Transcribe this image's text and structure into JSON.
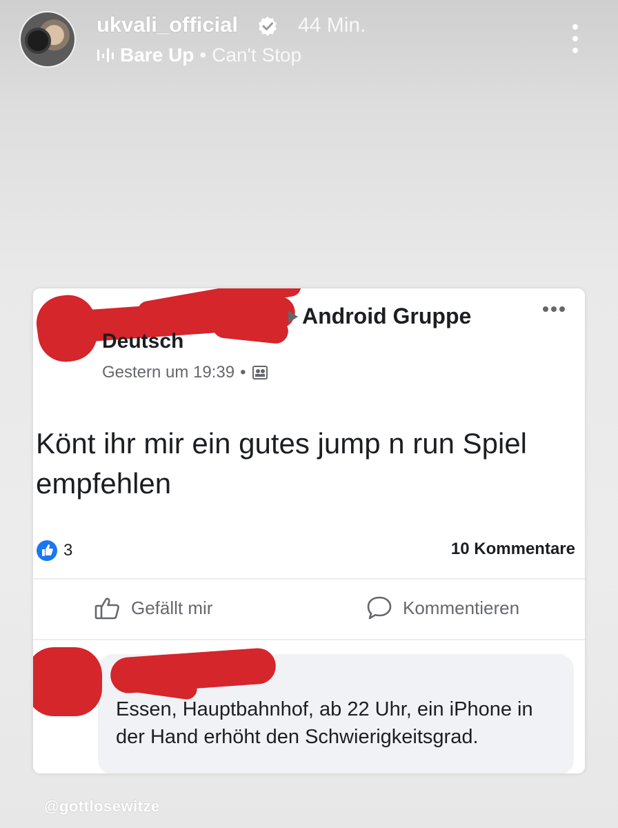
{
  "story": {
    "username": "ukvali_official",
    "time": "44 Min.",
    "song": "Bare Up",
    "separator": "•",
    "artist": "Can't Stop",
    "icons": [
      "avatar",
      "verified-icon",
      "music-bars-icon",
      "more-vert-icon"
    ]
  },
  "post": {
    "group_name_line1": "Android Gruppe",
    "group_name_line2": "Deutsch",
    "timestamp": "Gestern um 19:39",
    "meta_separator": "•",
    "text": "Könt ihr mir ein gutes jump n run Spiel empfehlen",
    "reaction_count": "3",
    "comments_count": "10 Kommentare",
    "like_label": "Gefällt mir",
    "comment_label": "Kommentieren",
    "comment_text": "Essen, Hauptbahnhof, ab 22 Uhr, ein iPhone in der Hand erhöht den Schwierigkeitsgrad.",
    "redaction_color": "#d4262b",
    "like_color": "#1877f2"
  },
  "watermark": "@gottlosewitze"
}
